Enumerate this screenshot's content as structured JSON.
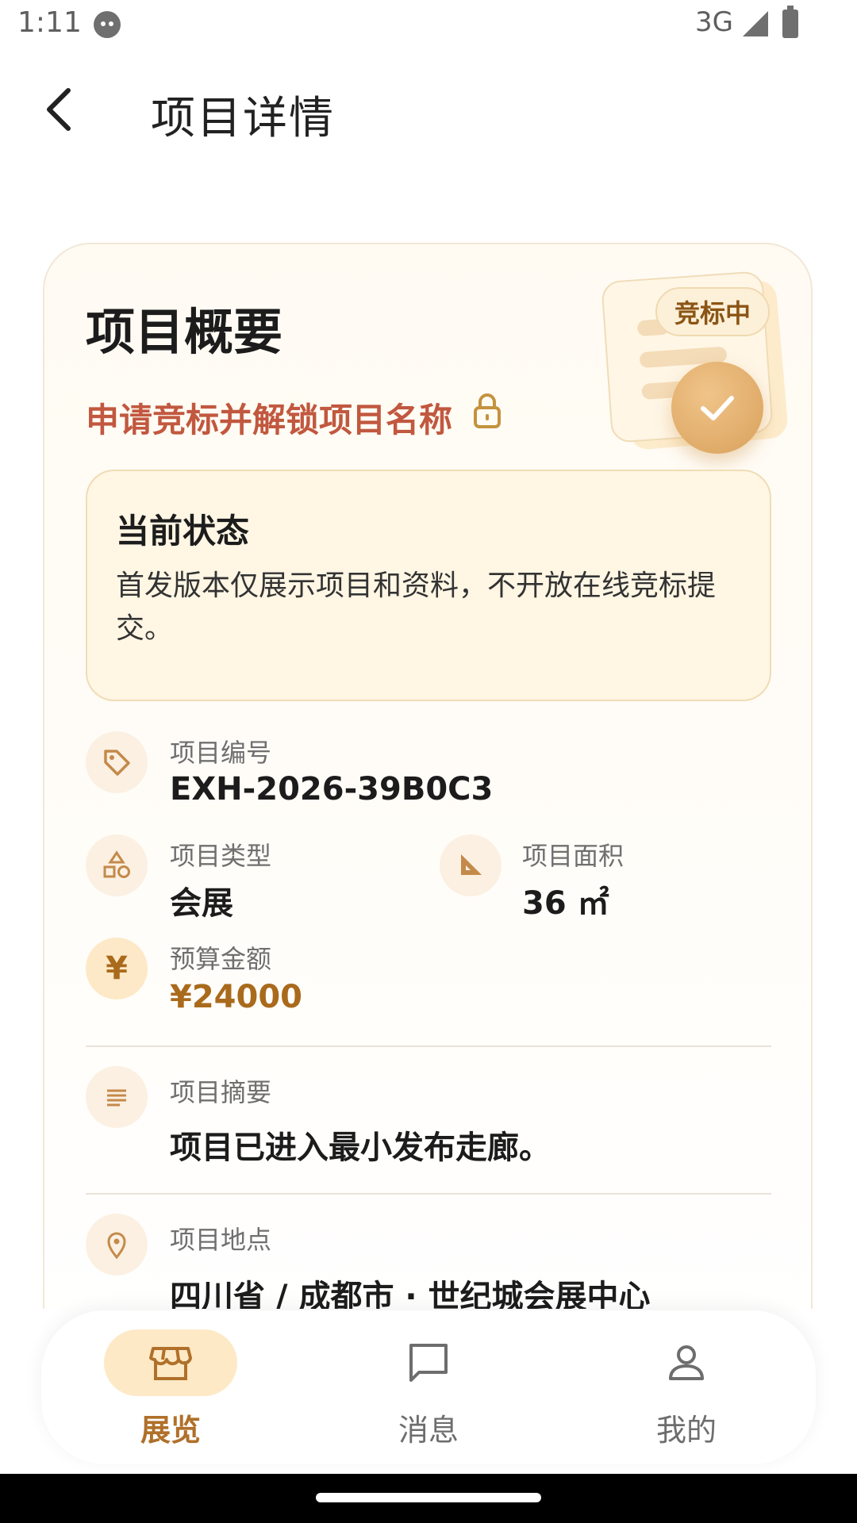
{
  "status_bar": {
    "time": "1:11",
    "network": "3G"
  },
  "header": {
    "title": "项目详情"
  },
  "card": {
    "title": "项目概要",
    "unlock_text": "申请竞标并解锁项目名称",
    "status_pill": "竞标中",
    "status_box": {
      "title": "当前状态",
      "text": "首发版本仅展示项目和资料，不开放在线竞标提交。"
    },
    "fields": {
      "code": {
        "label": "项目编号",
        "value": "EXH-2026-39B0C3"
      },
      "type": {
        "label": "项目类型",
        "value": "会展"
      },
      "area": {
        "label": "项目面积",
        "value": "36 ㎡"
      },
      "budget": {
        "label": "预算金额",
        "value": "¥24000"
      },
      "summary": {
        "label": "项目摘要",
        "value": "项目已进入最小发布走廊。"
      },
      "location": {
        "label": "项目地点",
        "value": "四川省 / 成都市 · 世纪城会展中心"
      }
    }
  },
  "bottom_nav": {
    "items": [
      {
        "label": "展览",
        "icon": "store-icon",
        "active": true
      },
      {
        "label": "消息",
        "icon": "message-icon",
        "active": false
      },
      {
        "label": "我的",
        "icon": "person-icon",
        "active": false
      }
    ]
  },
  "colors": {
    "accent": "#b0702a",
    "warning_text": "#c1583f",
    "highlight_bg": "#fde9c6"
  }
}
